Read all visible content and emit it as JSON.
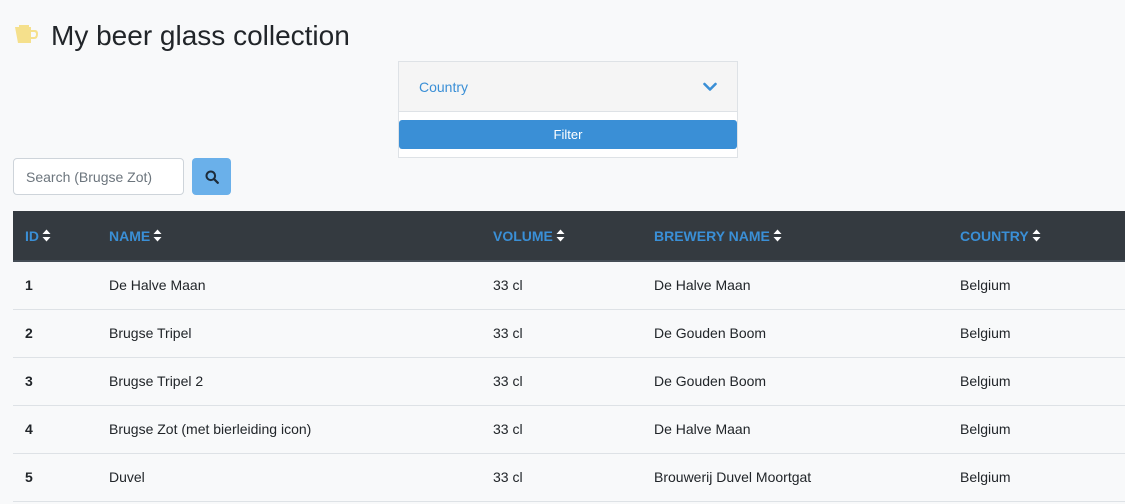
{
  "page": {
    "title": "My beer glass collection"
  },
  "icons": {
    "title_icon": "beer-mug-icon",
    "dropdown_icon": "chevron-down-icon",
    "search_icon": "search-icon",
    "sort_icon": "sort-icon"
  },
  "colors": {
    "accent": "#3a8fd6",
    "header_bg": "#343a40",
    "icon_yellow": "#f5e08c",
    "search_button": "#6ab0ea"
  },
  "filter": {
    "country_label": "Country",
    "button_label": "Filter"
  },
  "search": {
    "placeholder": "Search (Brugse Zot)",
    "value": ""
  },
  "table": {
    "columns": [
      {
        "label": "ID"
      },
      {
        "label": "NAME"
      },
      {
        "label": "VOLUME"
      },
      {
        "label": "BREWERY NAME"
      },
      {
        "label": "COUNTRY"
      }
    ],
    "rows": [
      {
        "id": "1",
        "name": "De Halve Maan",
        "volume": "33 cl",
        "brewery": "De Halve Maan",
        "country": "Belgium"
      },
      {
        "id": "2",
        "name": "Brugse Tripel",
        "volume": "33 cl",
        "brewery": "De Gouden Boom",
        "country": "Belgium"
      },
      {
        "id": "3",
        "name": "Brugse Tripel 2",
        "volume": "33 cl",
        "brewery": "De Gouden Boom",
        "country": "Belgium"
      },
      {
        "id": "4",
        "name": "Brugse Zot (met bierleiding icon)",
        "volume": "33 cl",
        "brewery": "De Halve Maan",
        "country": "Belgium"
      },
      {
        "id": "5",
        "name": "Duvel",
        "volume": "33 cl",
        "brewery": "Brouwerij Duvel Moortgat",
        "country": "Belgium"
      }
    ]
  }
}
